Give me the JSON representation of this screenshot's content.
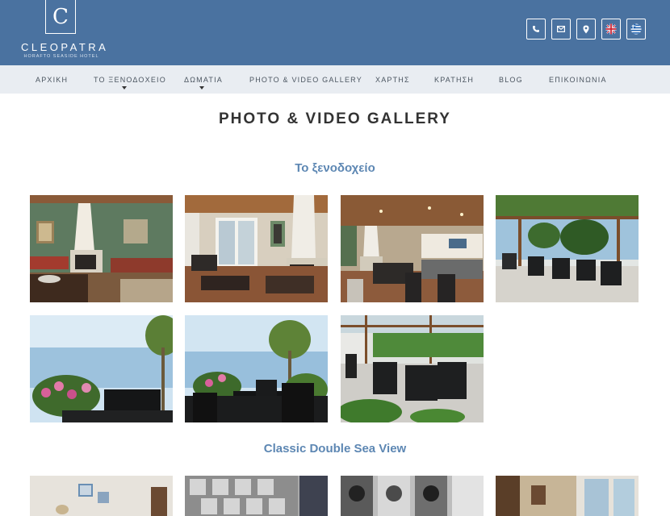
{
  "brand": {
    "logo_letter": "C",
    "name": "CLEOPATRA",
    "subtitle": "HORAFTO SEASIDE HOTEL"
  },
  "header_icons": [
    {
      "icon": "phone-icon"
    },
    {
      "icon": "mail-icon"
    },
    {
      "icon": "map-pin-icon"
    },
    {
      "icon": "uk-flag-icon"
    },
    {
      "icon": "greek-flag-icon"
    }
  ],
  "nav": {
    "items": [
      {
        "label": "ΑΡΧΙΚΗ"
      },
      {
        "label": "ΤΟ ΞΕΝΟΔΟΧΕΙΟ",
        "has_dropdown": true
      },
      {
        "label": "ΔΩΜΑΤΙΑ",
        "has_dropdown": true
      },
      {
        "label": "PHOTO & VIDEO GALLERY"
      },
      {
        "label": "ΧΑΡΤΗΣ"
      },
      {
        "label": "ΚΡΑΤΗΣΗ"
      },
      {
        "label": "BLOG"
      },
      {
        "label": "ΕΠΙΚΟΙΝΩΝΙΑ"
      }
    ]
  },
  "page": {
    "title": "PHOTO & VIDEO GALLERY"
  },
  "sections": [
    {
      "title": "Το ξενοδοχείο",
      "photo_count_visible": 7
    },
    {
      "title": "Classic Double Sea View",
      "photo_count_visible": 4
    }
  ],
  "colors": {
    "header_bg": "#4a72a0",
    "nav_bg": "#e9edf2",
    "accent_text": "#5d87b3"
  }
}
